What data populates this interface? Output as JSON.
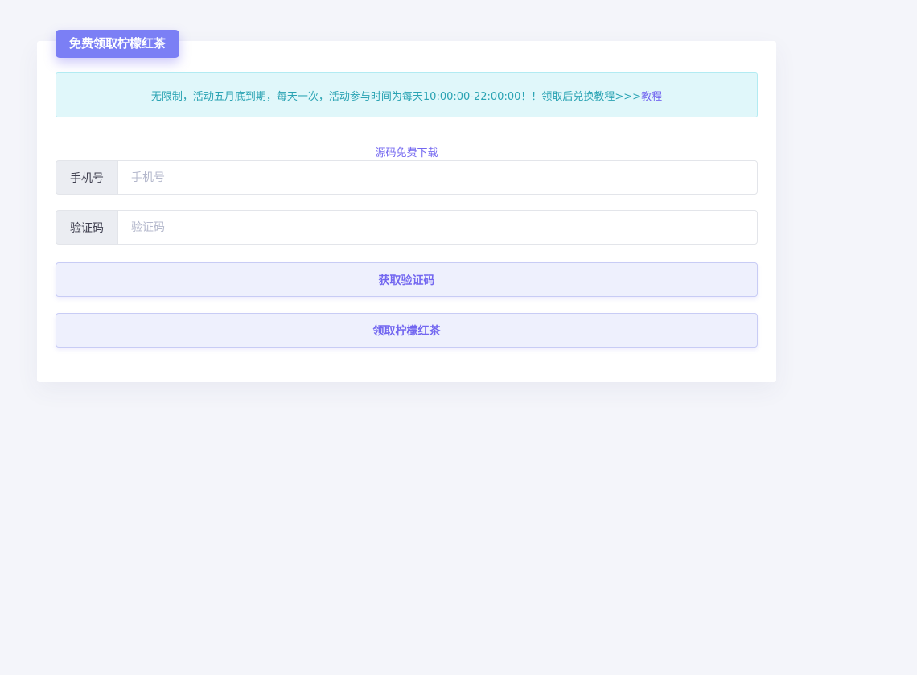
{
  "header": {
    "title": "免费领取柠檬红茶"
  },
  "notice": {
    "text": "无限制，活动五月底到期，每天一次，活动参与时间为每天10:00:00-22:00:00！！领取后兑换教程>>>",
    "link_label": "教程"
  },
  "source_link": {
    "label": "源码免费下载"
  },
  "form": {
    "phone": {
      "label": "手机号",
      "placeholder": "手机号",
      "value": ""
    },
    "code": {
      "label": "验证码",
      "placeholder": "验证码",
      "value": ""
    }
  },
  "buttons": {
    "get_code": "获取验证码",
    "claim": "领取柠檬红茶"
  },
  "colors": {
    "accent": "#7367f0",
    "notice_bg": "#e0f7fa",
    "notice_text": "#2aa3b3",
    "page_bg": "#f4f5fa"
  }
}
